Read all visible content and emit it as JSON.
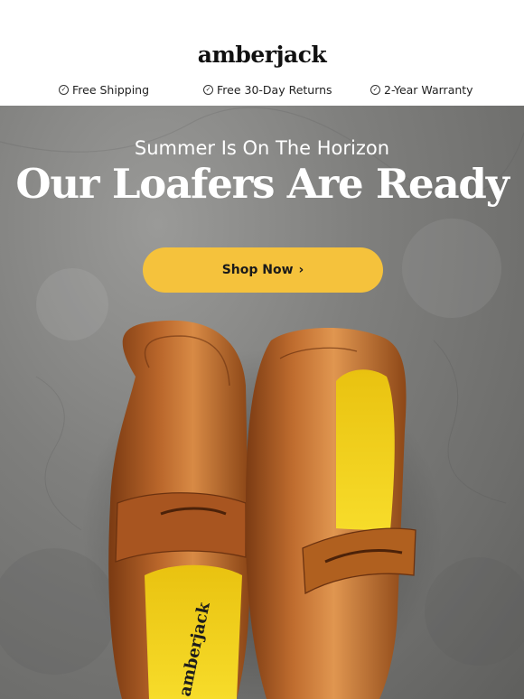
{
  "brand": {
    "name": "amberjack"
  },
  "perks": [
    {
      "label": "Free Shipping",
      "icon": "check-circle-icon"
    },
    {
      "label": "Free 30-Day Returns",
      "icon": "check-circle-icon"
    },
    {
      "label": "2-Year Warranty",
      "icon": "check-circle-icon"
    }
  ],
  "hero": {
    "kicker": "Summer Is On The Horizon",
    "headline": "Our Loafers Are Ready",
    "cta_label": "Shop Now",
    "cta_icon": "chevron-right-icon",
    "sole_brand": "amberjack"
  },
  "colors": {
    "accent": "#f5c23c",
    "leather": "#b8652a",
    "insole": "#f2d21a",
    "concrete": "#7f7f7d"
  }
}
